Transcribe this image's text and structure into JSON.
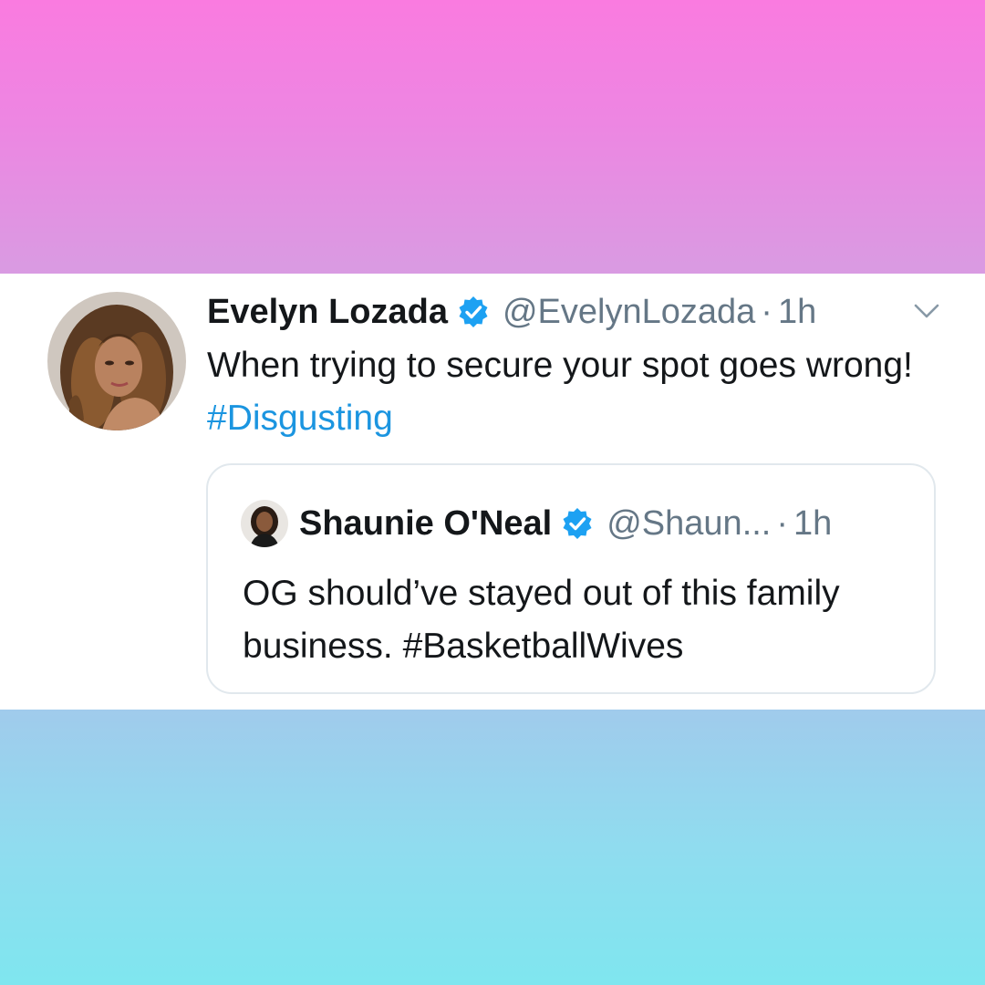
{
  "colors": {
    "top_gradient_start": "#fa7be0",
    "top_gradient_end": "#d99be2",
    "bottom_gradient_start": "#a0cbec",
    "bottom_gradient_end": "#7fe6ef",
    "link": "#1b95e0",
    "verified": "#1da1f2"
  },
  "tweet": {
    "author_name": "Evelyn Lozada",
    "handle": "@EvelynLozada",
    "separator": "·",
    "time": "1h",
    "text_plain": "When trying to secure your spot goes wrong! ",
    "hashtag": "#Disgusting",
    "icons": {
      "verified": "verified-badge-icon",
      "menu": "chevron-down-icon"
    }
  },
  "quoted_tweet": {
    "author_name": "Shaunie O'Neal",
    "handle": "@Shaun...",
    "separator": "·",
    "time": "1h",
    "text": "OG should’ve stayed out of this family business. #BasketballWives"
  }
}
